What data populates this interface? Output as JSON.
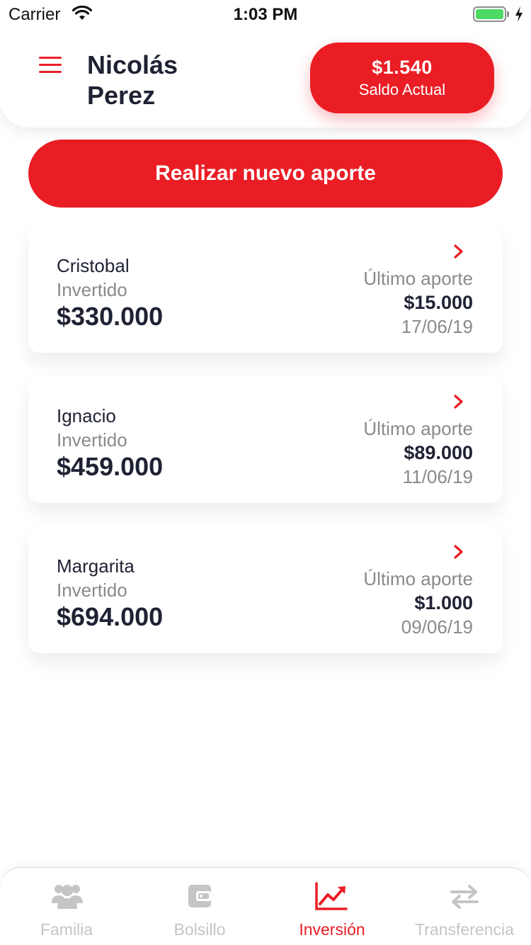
{
  "status_bar": {
    "carrier": "Carrier",
    "time": "1:03 PM"
  },
  "header": {
    "user_name_first": "Nicolás",
    "user_name_last": "Perez",
    "balance_amount": "$1.540",
    "balance_label": "Saldo Actual"
  },
  "actions": {
    "new_contribution_label": "Realizar nuevo aporte"
  },
  "cards": [
    {
      "name": "Cristobal",
      "invested_label": "Invertido",
      "invested_amount": "$330.000",
      "last_label": "Último aporte",
      "last_amount": "$15.000",
      "last_date": "17/06/19"
    },
    {
      "name": "Ignacio",
      "invested_label": "Invertido",
      "invested_amount": "$459.000",
      "last_label": "Último aporte",
      "last_amount": "$89.000",
      "last_date": "11/06/19"
    },
    {
      "name": "Margarita",
      "invested_label": "Invertido",
      "invested_amount": "$694.000",
      "last_label": "Último aporte",
      "last_amount": "$1.000",
      "last_date": "09/06/19"
    }
  ],
  "tab_bar": {
    "active": "Inversión",
    "tabs": [
      {
        "label": "Familia",
        "icon": "family-icon"
      },
      {
        "label": "Bolsillo",
        "icon": "wallet-icon"
      },
      {
        "label": "Inversión",
        "icon": "trending-up-icon"
      },
      {
        "label": "Transferencia",
        "icon": "transfer-icon"
      }
    ]
  },
  "colors": {
    "accent": "#ea1d25",
    "text_dark": "#1f2233",
    "text_muted": "#8a8a8e",
    "tab_inactive": "#c5c5c8",
    "battery": "#4cd964"
  }
}
